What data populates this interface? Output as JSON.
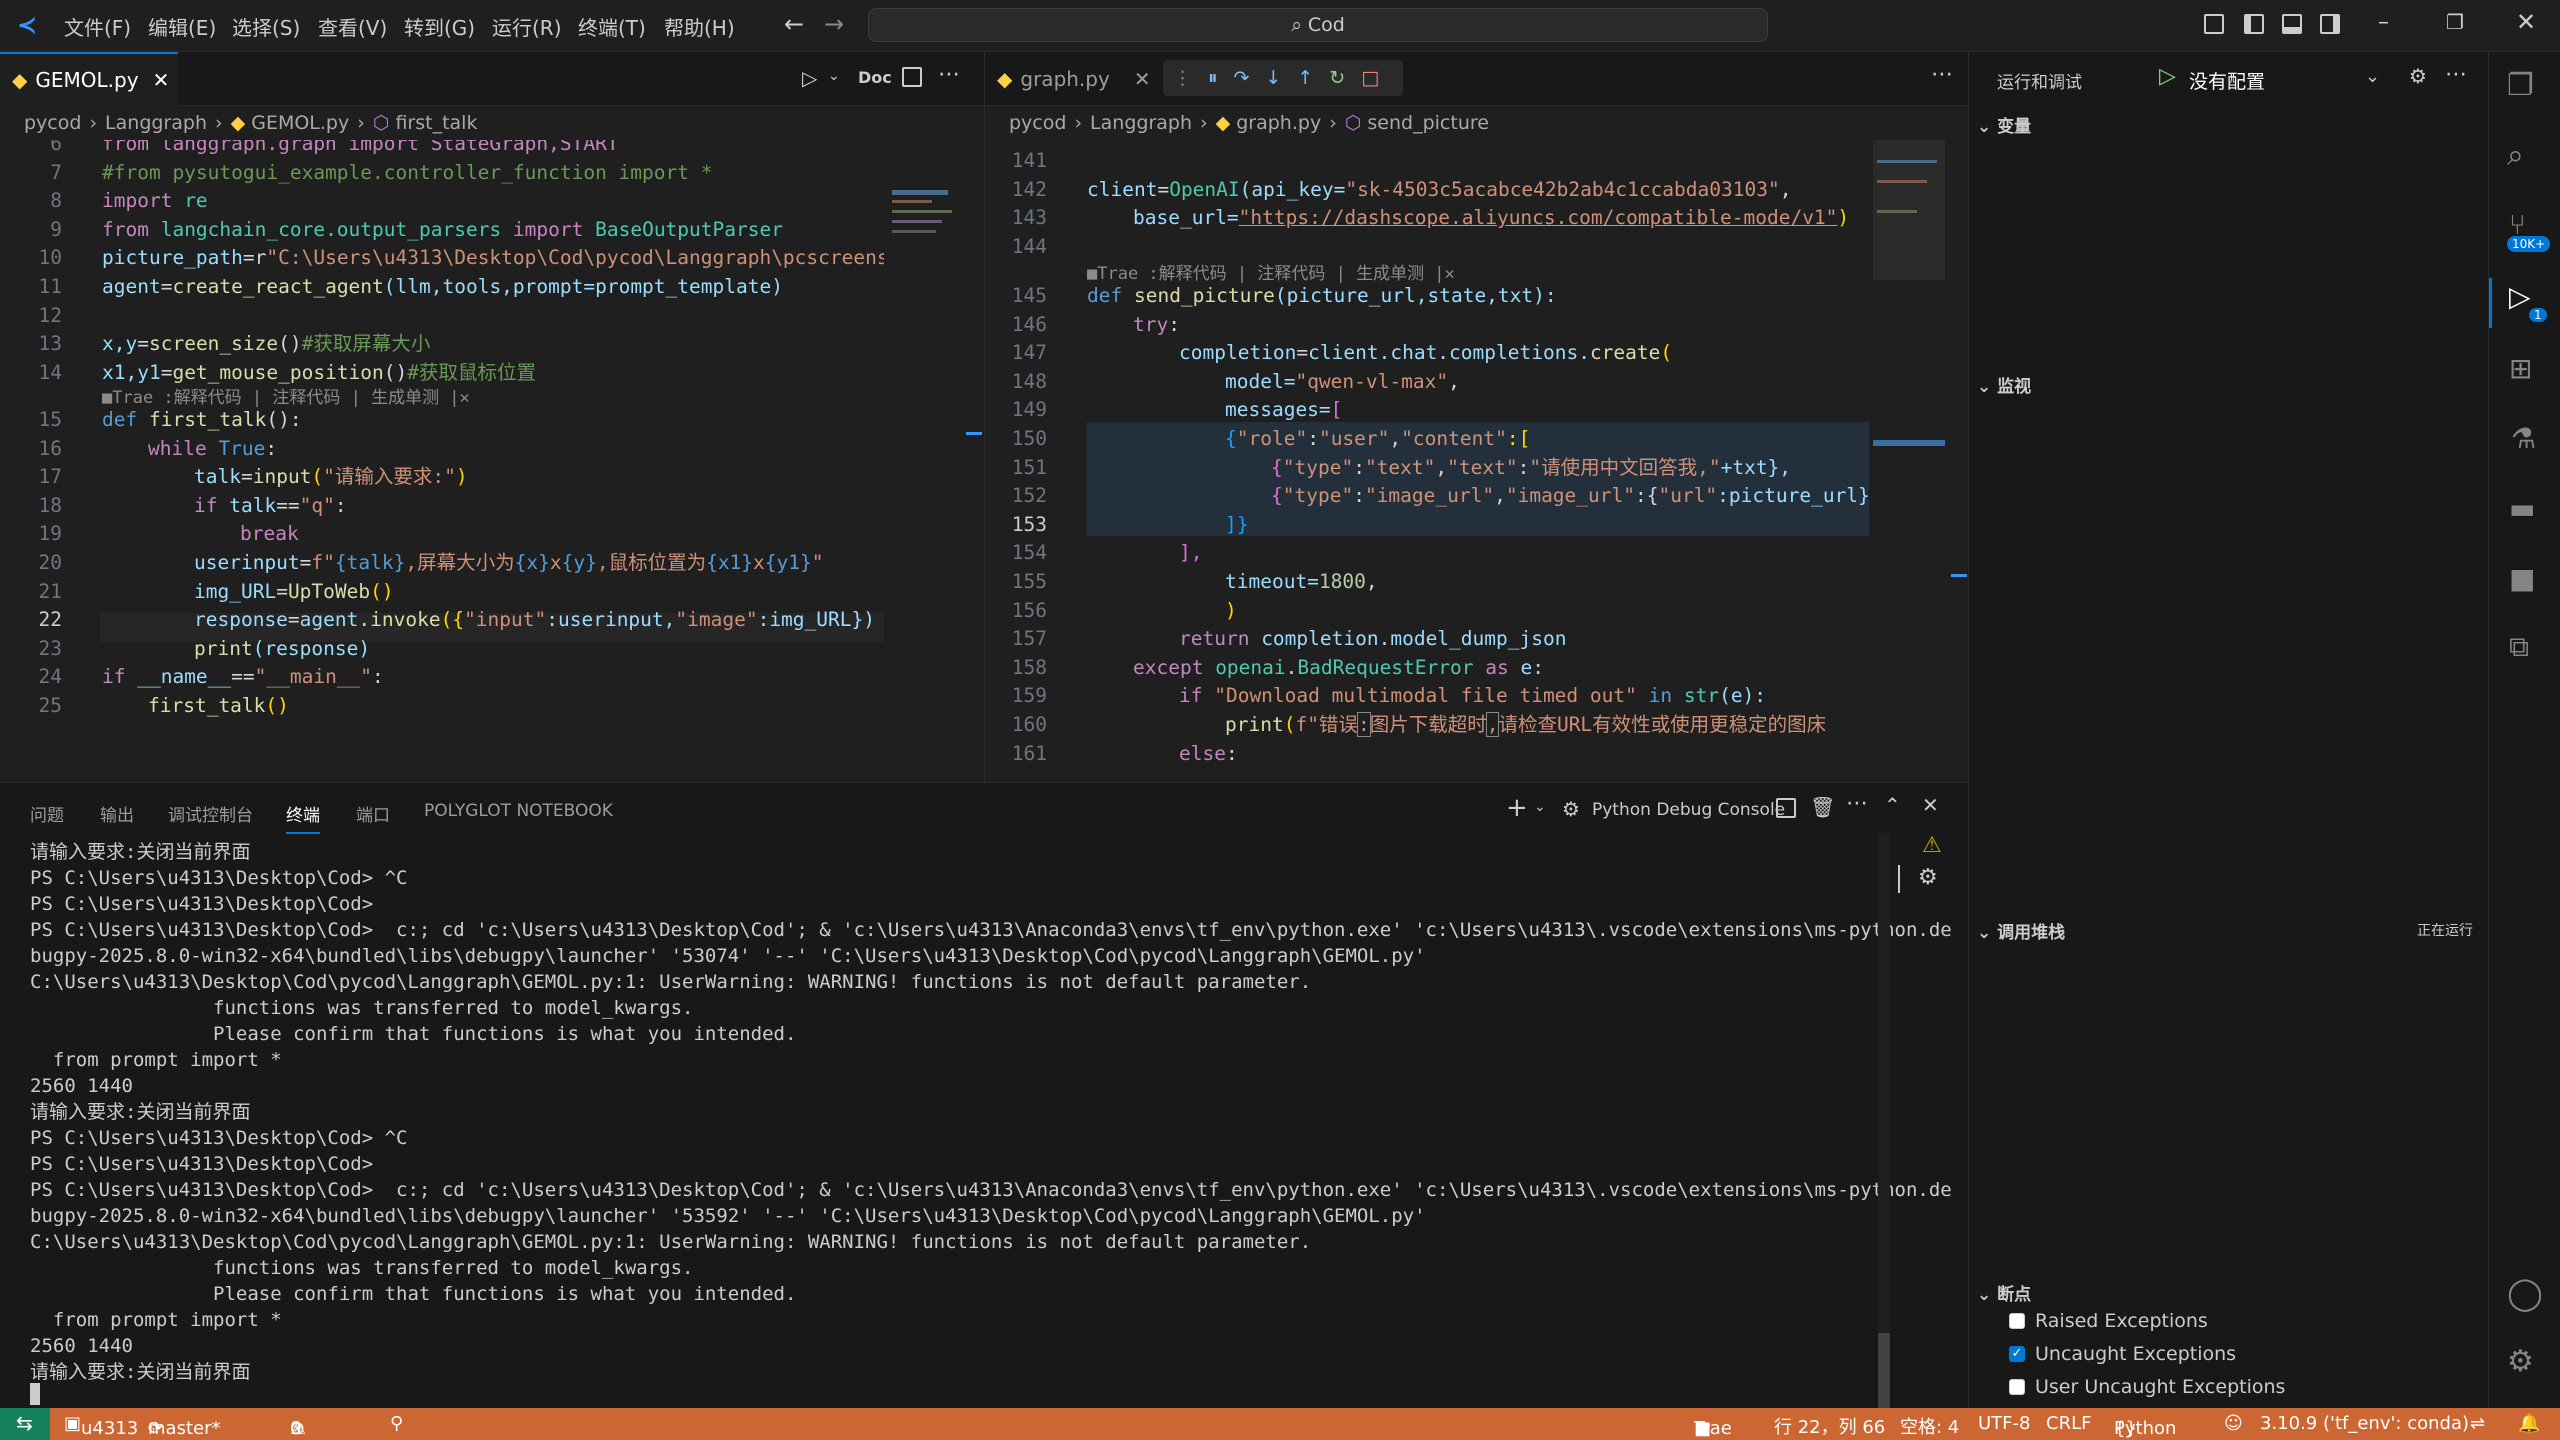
{
  "titlebar": {
    "menus": [
      "文件(F)",
      "编辑(E)",
      "选择(S)",
      "查看(V)",
      "转到(G)",
      "运行(R)",
      "终端(T)",
      "帮助(H)"
    ],
    "search": "Cod"
  },
  "left_editor": {
    "tab": "GEMOL.py",
    "doc_label": "Doc",
    "breadcrumb": [
      "pycod",
      "Langgraph",
      "GEMOL.py",
      "first_talk"
    ],
    "lens": "Trae :解释代码 | 注释代码 | 生成单测 |",
    "lines": {
      "n": [
        "6",
        "7",
        "8",
        "9",
        "10",
        "11",
        "12",
        "13",
        "14",
        "15",
        "16",
        "17",
        "18",
        "19",
        "20",
        "21",
        "22",
        "23",
        "24",
        "25"
      ],
      "l6": "from langgraph.graph import StateGraph,START",
      "l7": "#from pysutogui_example.controller_function import *",
      "l8a": "import",
      "l8b": " re",
      "l9a": "from",
      "l9b": " langchain_core.output_parsers ",
      "l9c": "import",
      "l9d": " BaseOutputParser",
      "l10a": "picture_path",
      "l10b": "=r",
      "l10c": "\"C:\\Users\\u4313\\Desktop\\Cod\\pycod\\Langgraph\\pcscreensh",
      "l11a": "agent",
      "l11b": "=",
      "l11c": "create_react_agent",
      "l11d": "(llm,tools,prompt=prompt_template)",
      "l13a": "x,y",
      "l13b": "=",
      "l13c": "screen_size",
      "l13d": "()",
      "l13e": "#获取屏幕大小",
      "l14a": "x1,y1",
      "l14b": "=",
      "l14c": "get_mouse_position",
      "l14d": "()",
      "l14e": "#获取鼠标位置",
      "l15a": "def",
      "l15b": " first_talk",
      "l15c": "():",
      "l16a": "while",
      "l16b": " True",
      ":": ":",
      "l17a": "talk",
      "l17b": "=",
      "l17c": "input",
      "l17d": "(",
      "l17e": "\"请输入要求:\"",
      "l17f": ")",
      "l18a": "if",
      "l18b": " talk",
      "l18c": "==",
      "l18d": "\"q\"",
      "l18e": ":",
      "l19": "break",
      "l20a": "userinput",
      "l20b": "=",
      "l20c": "f\"",
      "l20d": "{talk}",
      "l20e": ",屏幕大小为",
      "l20f": "{x}",
      "l20g": "x",
      "l20h": "{y}",
      "l20i": ",鼠标位置为",
      "l20j": "{x1}",
      "l20k": "x",
      "l20l": "{y1}",
      "l20m": "\"",
      "l21a": "img_URL",
      "l21b": "=",
      "l21c": "UpToWeb",
      "l21d": "()",
      "l22a": "response",
      "l22b": "=",
      "l22c": "agent",
      "l22d": ".",
      "l22e": "invoke",
      "l22f": "({",
      "l22g": "\"input\"",
      "l22h": ":userinput,",
      "l22i": "\"image\"",
      "l22j": ":img_URL})",
      "l23a": "print",
      "l23b": "(response)",
      "l24a": "if",
      "l24b": " __name__",
      "l24c": "==",
      "l24d": "\"__main__\"",
      "l24e": ":",
      "l25a": "first_talk",
      "l25b": "()"
    }
  },
  "right_editor": {
    "tab": "graph.py",
    "breadcrumb": [
      "pycod",
      "Langgraph",
      "graph.py",
      "send_picture"
    ],
    "lens": "Trae :解释代码 | 注释代码 | 生成单测 |",
    "n": [
      "141",
      "142",
      "143",
      "144",
      "145",
      "146",
      "147",
      "148",
      "149",
      "150",
      "151",
      "152",
      "153",
      "154",
      "155",
      "156",
      "157",
      "158",
      "159",
      "160",
      "161"
    ],
    "l142a": "client",
    "l142b": "=",
    "l142c": "OpenAI",
    "l142d": "(api_key=",
    "l142e": "\"sk-4503c5acabce42b2ab4c1ccabda03103\"",
    "l142f": ",",
    "l143a": "base_url=",
    "l143b": "\"https://dashscope.aliyuncs.com/compatible-mode/v1\"",
    "l143c": ")",
    "l145a": "def",
    "l145b": " send_picture",
    "l145c": "(picture_url,state,txt):",
    "l146a": "try",
    ":": ":",
    "l147a": "completion",
    "l147b": "=",
    "l147c": "client",
    "l147d": ".chat.completions.",
    "l147e": "create",
    "l147f": "(",
    "l148a": "model=",
    "l148b": "\"qwen-vl-max\"",
    "l148c": ",",
    "l149a": "messages=",
    "l149b": "[",
    "l150a": "{",
    "l150b": "\"role\"",
    "l150c": ":",
    "l150d": "\"user\"",
    "l150e": ",",
    "l150f": "\"content\"",
    "l150g": ":[",
    "l151a": "{",
    "l151b": "\"type\"",
    "l151c": ":",
    "l151d": "\"text\"",
    "l151e": ",",
    "l151f": "\"text\"",
    "l151g": ":",
    "l151h": "\"请使用中文回答我,\"",
    "l151i": "+txt},",
    "l152a": "{",
    "l152b": "\"type\"",
    "l152c": ":",
    "l152d": "\"image_url\"",
    "l152e": ",",
    "l152f": "\"image_url\"",
    "l152g": ":{",
    "l152h": "\"url\"",
    "l152i": ":picture_url}}",
    "l153": "]}",
    "l154": "],",
    "l155a": "timeout=",
    "l155b": "1800",
    ",": ",",
    "l156": ")",
    "l157a": "return",
    "l157b": " completion",
    "l157c": ".",
    "l157d": "model_dump_json",
    "l158a": "except",
    "l158b": " openai",
    "l158c": ".",
    "l158d": "BadRequestError",
    "l158e": " as",
    "l158f": " e:",
    "l159a": "if",
    "l159b": " \"Download multimodal file timed out\"",
    "l159c": " in",
    "l159d": " str",
    "l159e": "(e):",
    "l160a": "print",
    "l160b": "(",
    "l160c": "f\"错误",
    "l160d": ":",
    "l160e": "图片下载超时",
    "l160f": ",",
    "l160g": "请检查URL有效性或使用更稳定的图床",
    "l161a": "else"
  },
  "panel": {
    "tabs": [
      "问题",
      "输出",
      "调试控制台",
      "终端",
      "端口",
      "POLYGLOT NOTEBOOK"
    ],
    "console_label": "Python Debug Console",
    "terminal": [
      "请输入要求:关闭当前界面",
      "PS C:\\Users\\u4313\\Desktop\\Cod> ^C",
      "PS C:\\Users\\u4313\\Desktop\\Cod>",
      "PS C:\\Users\\u4313\\Desktop\\Cod>  c:; cd 'c:\\Users\\u4313\\Desktop\\Cod'; & 'c:\\Users\\u4313\\Anaconda3\\envs\\tf_env\\python.exe' 'c:\\Users\\u4313\\.vscode\\extensions\\ms-python.de",
      "bugpy-2025.8.0-win32-x64\\bundled\\libs\\debugpy\\launcher' '53074' '--' 'C:\\Users\\u4313\\Desktop\\Cod\\pycod\\Langgraph\\GEMOL.py'",
      "C:\\Users\\u4313\\Desktop\\Cod\\pycod\\Langgraph\\GEMOL.py:1: UserWarning: WARNING! functions is not default parameter.",
      "                functions was transferred to model_kwargs.",
      "                Please confirm that functions is what you intended.",
      "  from prompt import *",
      "2560 1440",
      "请输入要求:关闭当前界面",
      "PS C:\\Users\\u4313\\Desktop\\Cod> ^C",
      "PS C:\\Users\\u4313\\Desktop\\Cod>",
      "PS C:\\Users\\u4313\\Desktop\\Cod>  c:; cd 'c:\\Users\\u4313\\Desktop\\Cod'; & 'c:\\Users\\u4313\\Anaconda3\\envs\\tf_env\\python.exe' 'c:\\Users\\u4313\\.vscode\\extensions\\ms-python.de",
      "bugpy-2025.8.0-win32-x64\\bundled\\libs\\debugpy\\launcher' '53592' '--' 'C:\\Users\\u4313\\Desktop\\Cod\\pycod\\Langgraph\\GEMOL.py'",
      "C:\\Users\\u4313\\Desktop\\Cod\\pycod\\Langgraph\\GEMOL.py:1: UserWarning: WARNING! functions is not default parameter.",
      "                functions was transferred to model_kwargs.",
      "                Please confirm that functions is what you intended.",
      "  from prompt import *",
      "2560 1440",
      "请输入要求:关闭当前界面"
    ]
  },
  "sidebar": {
    "title": "运行和调试",
    "config": "没有配置",
    "variables": "变量",
    "watch": "监视",
    "callstack": "调用堆栈",
    "callstack_status": "正在运行",
    "breakpoints": "断点",
    "bp_items": [
      "Raised Exceptions",
      "Uncaught Exceptions",
      "User Uncaught Exceptions"
    ]
  },
  "activity": {
    "badge1": "10K+",
    "badge2": "1"
  },
  "status": {
    "user": "u4313",
    "branch": "master*",
    "errors": "0",
    "warnings": "0",
    "trae": "Trae",
    "position": "行 22，列 66",
    "spaces": "空格: 4",
    "encoding": "UTF-8",
    "eol": "CRLF",
    "lang": "Python",
    "interp": "3.10.9 ('tf_env': conda)"
  },
  "colors": {
    "status_bg": "#cc6633",
    "accent": "#0078d4"
  }
}
